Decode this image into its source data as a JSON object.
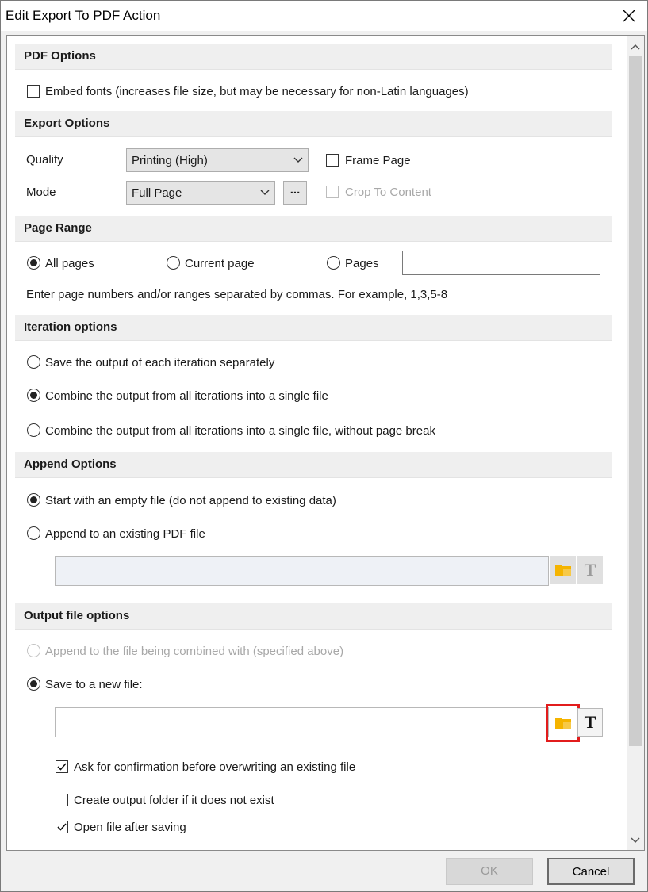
{
  "window": {
    "title": "Edit Export To PDF Action"
  },
  "pdf_options": {
    "header": "PDF Options",
    "embed_fonts": {
      "label": "Embed fonts (increases file size, but may be necessary for non-Latin languages)",
      "checked": false
    }
  },
  "export_options": {
    "header": "Export Options",
    "quality_label": "Quality",
    "quality_value": "Printing (High)",
    "mode_label": "Mode",
    "mode_value": "Full Page",
    "mode_more": "...",
    "frame_page": {
      "label": "Frame Page",
      "checked": false
    },
    "crop_to_content": {
      "label": "Crop To Content",
      "checked": false,
      "enabled": false
    }
  },
  "page_range": {
    "header": "Page Range",
    "all_pages": "All pages",
    "current_page": "Current page",
    "pages": "Pages",
    "pages_value": "",
    "selected": "all_pages",
    "hint": "Enter page numbers and/or ranges separated by commas. For example, 1,3,5-8"
  },
  "iteration_options": {
    "header": "Iteration options",
    "opt_separate": "Save the output of each iteration separately",
    "opt_combine": "Combine the output from all iterations into a single file",
    "opt_combine_nobreak": "Combine the output from all iterations into a single file, without page break",
    "selected": "opt_combine"
  },
  "append_options": {
    "header": "Append Options",
    "opt_empty": "Start with an empty file (do not append to existing data)",
    "opt_existing": "Append to an existing PDF file",
    "file_value": "",
    "selected": "opt_empty"
  },
  "output_file_options": {
    "header": "Output file options",
    "opt_append_combined": "Append to the file being combined with (specified above)",
    "opt_new_file": "Save to a new file:",
    "file_value": "",
    "selected": "opt_new_file",
    "ask_confirmation": {
      "label": "Ask for confirmation before overwriting an existing file",
      "checked": true
    },
    "create_folder": {
      "label": "Create output folder if it does not exist",
      "checked": false
    },
    "open_after": {
      "label": "Open file after saving",
      "checked": true
    }
  },
  "footer": {
    "ok_label": "OK",
    "cancel_label": "Cancel"
  },
  "icons": {
    "folder": "folder-icon",
    "text_field": "text-field-icon",
    "close": "close-icon"
  },
  "colors": {
    "highlight": "#e21c1c",
    "folder": "#f5b400"
  }
}
